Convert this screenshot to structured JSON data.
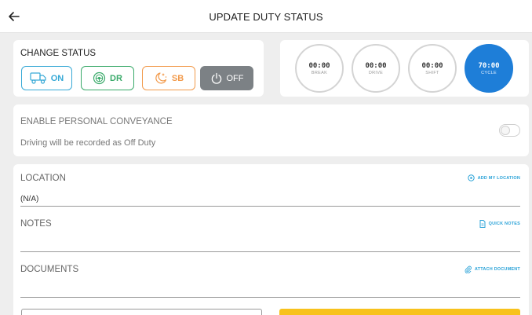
{
  "header": {
    "title": "UPDATE DUTY STATUS",
    "back_icon": "arrow-left-icon"
  },
  "change_status": {
    "title": "CHANGE STATUS",
    "buttons": [
      {
        "label": "ON",
        "icon": "truck-icon",
        "color": "#37a9d6"
      },
      {
        "label": "DR",
        "icon": "steering-wheel-icon",
        "color": "#3aaa6a"
      },
      {
        "label": "SB",
        "icon": "moon-stars-icon",
        "color": "#f29a4b"
      },
      {
        "label": "OFF",
        "icon": "power-icon",
        "color": "#7c8185",
        "selected": true
      }
    ]
  },
  "clocks": [
    {
      "time": "00:00",
      "label": "BREAK"
    },
    {
      "time": "00:00",
      "label": "DRIVE"
    },
    {
      "time": "00:00",
      "label": "SHIFT"
    },
    {
      "time": "70:00",
      "label": "CYCLE",
      "highlight_color": "#1e7ed8"
    }
  ],
  "personal_conveyance": {
    "title": "ENABLE PERSONAL CONVEYANCE",
    "subtitle": "Driving will be recorded as Off Duty",
    "enabled": false
  },
  "form": {
    "location": {
      "label": "LOCATION",
      "link": "ADD MY LOCATION",
      "link_icon": "location-target-icon",
      "value": "(N/A)"
    },
    "notes": {
      "label": "NOTES",
      "link": "QUICK NOTES",
      "link_icon": "document-icon",
      "value": ""
    },
    "documents": {
      "label": "DOCUMENTS",
      "link": "ATTACH DOCUMENT",
      "link_icon": "paperclip-icon",
      "value": ""
    }
  },
  "colors": {
    "accent_blue": "#2ba3d8",
    "cycle_blue": "#1e7ed8",
    "primary_yellow": "#f8c21c",
    "background": "#eeeeee"
  }
}
